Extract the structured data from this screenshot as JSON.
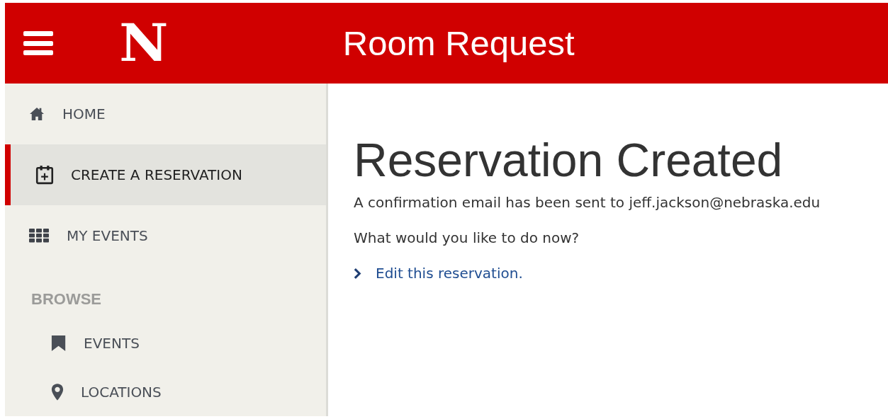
{
  "header": {
    "logo": "N",
    "title": "Room Request"
  },
  "sidebar": {
    "items": [
      {
        "kind": "link",
        "label": "HOME",
        "selected": false
      },
      {
        "kind": "link",
        "label": "CREATE A RESERVATION",
        "selected": true
      },
      {
        "kind": "link",
        "label": "MY EVENTS",
        "selected": false
      },
      {
        "kind": "section",
        "label": "BROWSE",
        "children": [
          {
            "kind": "link",
            "label": "EVENTS",
            "selected": false
          },
          {
            "kind": "link",
            "label": "LOCATIONS",
            "selected": false
          }
        ]
      }
    ]
  },
  "main": {
    "heading": "Reservation Created",
    "message": "A confirmation email has been sent to jeff.jackson@nebraska.edu",
    "question": "What would you like to do now?",
    "links": [
      "Edit this reservation."
    ]
  }
}
